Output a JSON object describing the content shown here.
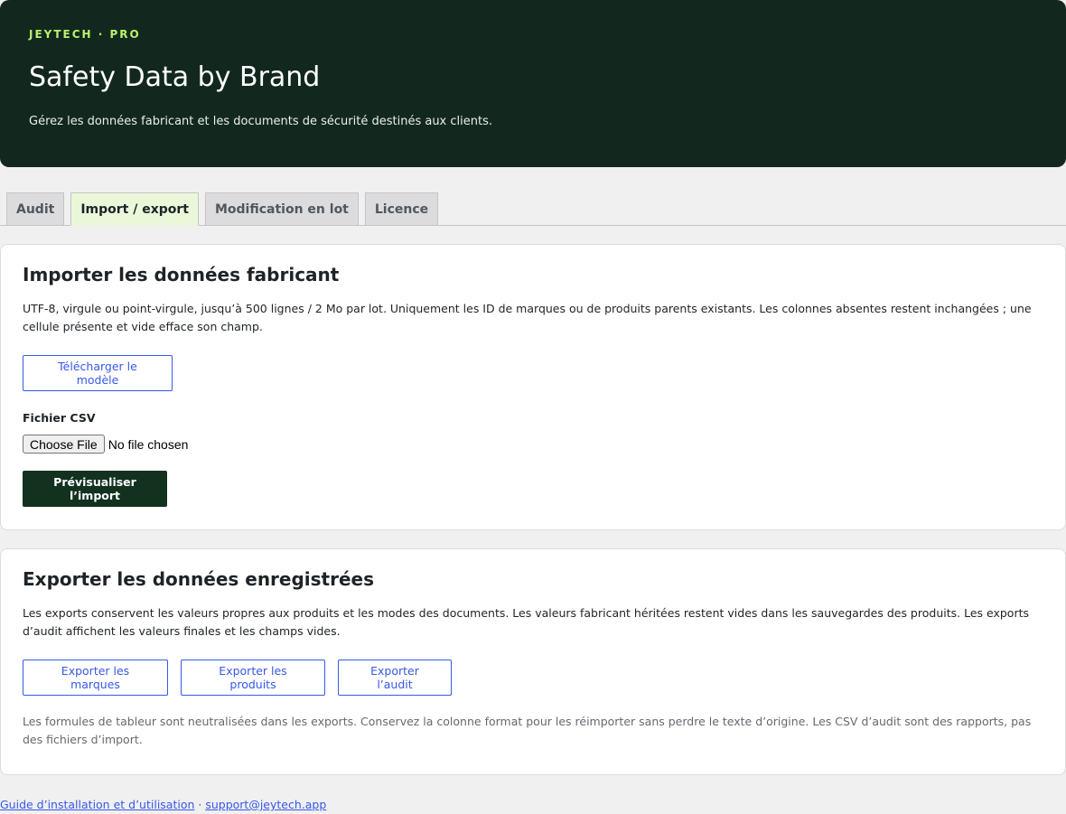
{
  "header": {
    "eyebrow": "JEYTECH · PRO",
    "title": "Safety Data by Brand",
    "subtitle": "Gérez les données fabricant et les documents de sécurité destinés aux clients."
  },
  "tabs": [
    {
      "label": "Audit",
      "active": false
    },
    {
      "label": "Import / export",
      "active": true
    },
    {
      "label": "Modification en lot",
      "active": false
    },
    {
      "label": "Licence",
      "active": false
    }
  ],
  "import_section": {
    "title": "Importer les données fabricant",
    "description": "UTF-8, virgule ou point-virgule, jusqu’à 500 lignes / 2 Mo par lot. Uniquement les ID de marques ou de produits parents existants. Les colonnes absentes restent inchangées ; une cellule présente et vide efface son champ.",
    "download_template_label": "Télécharger le modèle",
    "file_label": "Fichier CSV",
    "choose_file_label": "Choose File",
    "file_status": "No file chosen",
    "preview_label": "Prévisualiser l’import"
  },
  "export_section": {
    "title": "Exporter les données enregistrées",
    "description": "Les exports conservent les valeurs propres aux produits et les modes des documents. Les valeurs fabricant héritées restent vides dans les sauvegardes des produits. Les exports d’audit affichent les valeurs finales et les champs vides.",
    "export_brands_label": "Exporter les marques",
    "export_products_label": "Exporter les produits",
    "export_audit_label": "Exporter l’audit",
    "note": "Les formules de tableur sont neutralisées dans les exports. Conservez la colonne format pour les réimporter sans perdre le texte d’origine. Les CSV d’audit sont des rapports, pas des fichiers d’import."
  },
  "footer": {
    "guide_link": "Guide d’installation et d’utilisation",
    "separator": " · ",
    "support_link": "support@jeytech.app"
  },
  "colors": {
    "header_bg": "#12281f",
    "accent_green": "#b9f26b",
    "link_blue": "#3858e9",
    "primary_button": "#12321f",
    "active_tab_bg": "#eaf8d9"
  }
}
